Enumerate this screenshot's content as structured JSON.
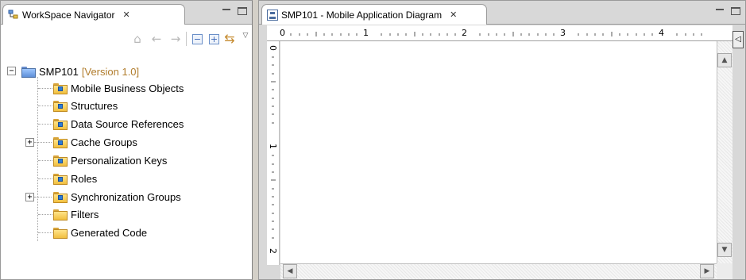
{
  "left_panel": {
    "tab_title": "WorkSpace Navigator",
    "tab_close": "✕",
    "toolbar": {
      "home": "⌂",
      "back": "←",
      "forward": "→",
      "collapse": "−",
      "expand": "+",
      "link": "⇆",
      "menu": "▽"
    },
    "tree": {
      "root_label": "SMP101",
      "root_version": "[Version 1.0]",
      "root_toggle": "−",
      "items": [
        {
          "label": "Mobile Business Objects"
        },
        {
          "label": "Structures"
        },
        {
          "label": "Data Source References"
        },
        {
          "label": "Cache Groups",
          "toggle": "+"
        },
        {
          "label": "Personalization Keys"
        },
        {
          "label": "Roles"
        },
        {
          "label": "Synchronization Groups",
          "toggle": "+"
        },
        {
          "label": "Filters"
        },
        {
          "label": "Generated Code"
        }
      ]
    }
  },
  "right_panel": {
    "tab_title": "SMP101 - Mobile Application Diagram",
    "tab_close": "✕",
    "ruler_h_labels": [
      "0",
      "1",
      "2",
      "3",
      "4"
    ],
    "ruler_v_labels": [
      "0",
      "1",
      "2"
    ],
    "scroll_up": "▲",
    "scroll_down": "▼",
    "scroll_left": "◀",
    "scroll_right": "▶",
    "ruler_toggle": "◁"
  }
}
